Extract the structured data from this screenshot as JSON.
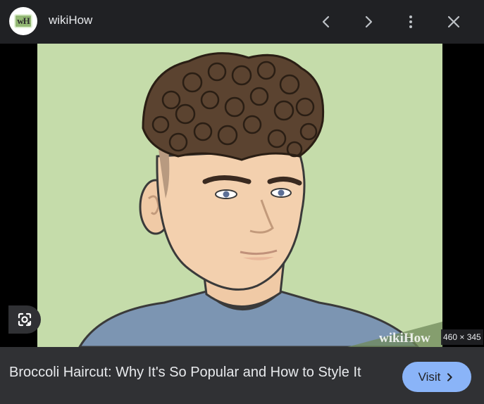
{
  "header": {
    "site_logo_text": "wH",
    "site_name": "wikiHow",
    "icons": {
      "prev": "chevron-left-icon",
      "next": "chevron-right-icon",
      "more": "more-vertical-icon",
      "close": "close-icon"
    }
  },
  "image": {
    "watermark": "wikiHow",
    "dimensions": "460 × 345",
    "lens_icon": "lens-icon"
  },
  "caption": {
    "title": "Broccoli Haircut: Why It's So Popular and How to Style It",
    "visit_label": "Visit",
    "visit_icon": "chevron-right-icon"
  },
  "colors": {
    "background": "#202124",
    "caption_bar": "#303134",
    "visit_button": "#8ab4f8",
    "image_backdrop": "#c5dcaa"
  }
}
